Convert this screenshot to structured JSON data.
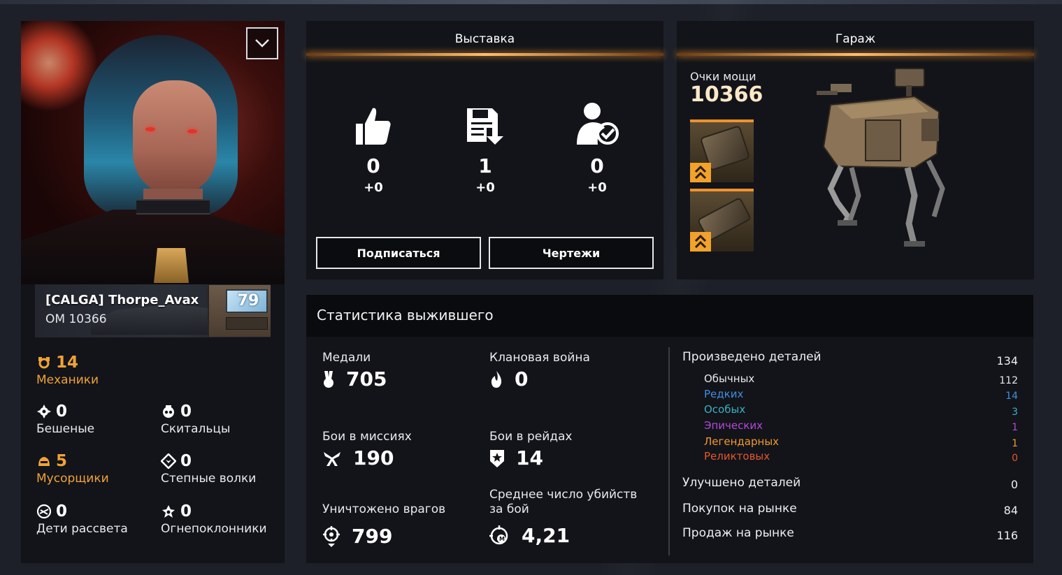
{
  "profile": {
    "player_name": "[CALGA] Thorpe_Avax",
    "om": "ОМ 10366",
    "level": "79",
    "factions": [
      {
        "key": "mechanics",
        "value": "14",
        "label": "Механики",
        "highlight": true,
        "icon": "mechanics-faction-icon"
      },
      {
        "key": "lunatics",
        "value": "0",
        "label": "Бешеные",
        "highlight": false,
        "icon": "lunatics-faction-icon"
      },
      {
        "key": "nomads",
        "value": "0",
        "label": "Скитальцы",
        "highlight": false,
        "icon": "nomads-faction-icon"
      },
      {
        "key": "scavengers",
        "value": "5",
        "label": "Мусорщики",
        "highlight": true,
        "icon": "scavengers-faction-icon"
      },
      {
        "key": "steppenwolfs",
        "value": "0",
        "label": "Степные волки",
        "highlight": false,
        "icon": "steppenwolfs-faction-icon"
      },
      {
        "key": "dawns_children",
        "value": "0",
        "label": "Дети рассвета",
        "highlight": false,
        "icon": "dawns-children-faction-icon"
      },
      {
        "key": "firestarters",
        "value": "0",
        "label": "Огнепоклонники",
        "highlight": false,
        "icon": "firestarters-faction-icon"
      }
    ]
  },
  "exhibition": {
    "title": "Выставка",
    "stats": [
      {
        "icon": "thumbs-up-icon",
        "value": "0",
        "delta": "+0"
      },
      {
        "icon": "save-download-icon",
        "value": "1",
        "delta": "+0"
      },
      {
        "icon": "subscribers-icon",
        "value": "0",
        "delta": "+0"
      }
    ],
    "subscribe_label": "Подписаться",
    "blueprints_label": "Чертежи"
  },
  "garage": {
    "title": "Гараж",
    "power_label": "Очки мощи",
    "power_value": "10366"
  },
  "survivor_stats": {
    "title": "Статистика выжившего",
    "medals": {
      "label": "Медали",
      "value": "705"
    },
    "clan_war": {
      "label": "Клановая война",
      "value": "0"
    },
    "mission_battles": {
      "label": "Бои в миссиях",
      "value": "190"
    },
    "raid_battles": {
      "label": "Бои в рейдах",
      "value": "14"
    },
    "enemies_destroyed": {
      "label": "Уничтожено врагов",
      "value": "799"
    },
    "avg_kills": {
      "label": "Среднее число убийств за бой",
      "value": "4,21"
    },
    "parts_produced": {
      "label": "Произведено деталей",
      "value": "134"
    },
    "rarity": [
      {
        "label": "Обычных",
        "value": "112",
        "color": "#e6e8ec"
      },
      {
        "label": "Редких",
        "value": "14",
        "color": "#3f8fe0"
      },
      {
        "label": "Особых",
        "value": "3",
        "color": "#3ab0c2"
      },
      {
        "label": "Эпических",
        "value": "1",
        "color": "#b24ad8"
      },
      {
        "label": "Легендарных",
        "value": "1",
        "color": "#f19a2c"
      },
      {
        "label": "Реликтовых",
        "value": "0",
        "color": "#e4582a"
      }
    ],
    "parts_upgraded": {
      "label": "Улучшено деталей",
      "value": "0"
    },
    "market_purchases": {
      "label": "Покупок на рынке",
      "value": "84"
    },
    "market_sales": {
      "label": "Продаж на рынке",
      "value": "116"
    }
  }
}
